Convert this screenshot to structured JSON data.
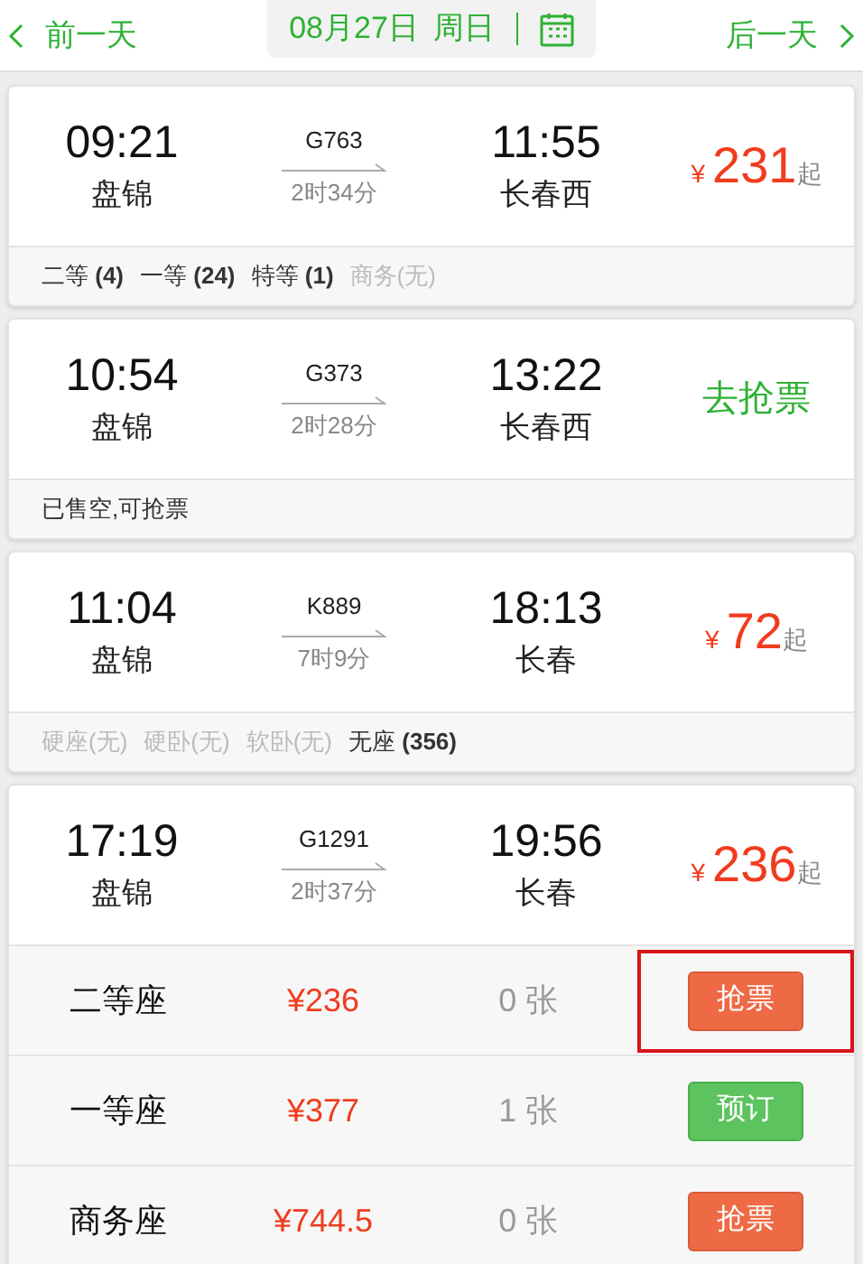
{
  "nav": {
    "prev": "前一天",
    "date": "08月27日",
    "weekday": "周日",
    "next": "后一天"
  },
  "trains": [
    {
      "depart_time": "09:21",
      "depart_station": "盘锦",
      "number": "G763",
      "duration": "2时34分",
      "arrive_time": "11:55",
      "arrive_station": "长春西",
      "action": {
        "kind": "price",
        "currency": "¥",
        "amount": "231",
        "suffix": "起"
      },
      "seat_summary": [
        {
          "text": "二等 **(4)**",
          "available": true
        },
        {
          "text": "一等 **(24)**",
          "available": true
        },
        {
          "text": "特等 **(1)**",
          "available": true
        },
        {
          "text": "商务(无)",
          "available": false
        }
      ]
    },
    {
      "depart_time": "10:54",
      "depart_station": "盘锦",
      "number": "G373",
      "duration": "2时28分",
      "arrive_time": "13:22",
      "arrive_station": "长春西",
      "action": {
        "kind": "grab",
        "label": "去抢票"
      },
      "seat_summary": [
        {
          "text": "已售空,可抢票",
          "available": true
        }
      ]
    },
    {
      "depart_time": "11:04",
      "depart_station": "盘锦",
      "number": "K889",
      "duration": "7时9分",
      "arrive_time": "18:13",
      "arrive_station": "长春",
      "action": {
        "kind": "price",
        "currency": "¥",
        "amount": "72",
        "suffix": "起"
      },
      "seat_summary": [
        {
          "text": "硬座(无)",
          "available": false
        },
        {
          "text": "硬卧(无)",
          "available": false
        },
        {
          "text": "软卧(无)",
          "available": false
        },
        {
          "text": "无座 **(356)**",
          "available": true
        }
      ]
    },
    {
      "depart_time": "17:19",
      "depart_station": "盘锦",
      "number": "G1291",
      "duration": "2时37分",
      "arrive_time": "19:56",
      "arrive_station": "长春",
      "action": {
        "kind": "price",
        "currency": "¥",
        "amount": "236",
        "suffix": "起"
      },
      "seats": [
        {
          "name": "二等座",
          "price": "¥236",
          "count": "0 张",
          "button": {
            "kind": "grab",
            "label": "抢票"
          },
          "highlighted": true
        },
        {
          "name": "一等座",
          "price": "¥377",
          "count": "1 张",
          "button": {
            "kind": "book",
            "label": "预订"
          },
          "highlighted": false
        },
        {
          "name": "商务座",
          "price": "¥744.5",
          "count": "0 张",
          "button": {
            "kind": "grab",
            "label": "抢票"
          },
          "highlighted": false
        }
      ]
    }
  ]
}
